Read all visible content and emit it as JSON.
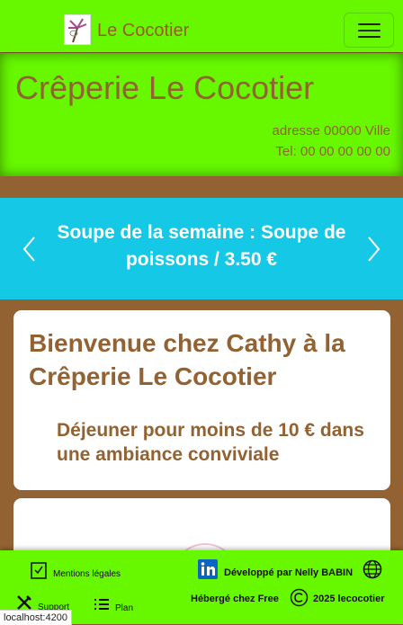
{
  "navbar": {
    "brand": "Le Cocotier",
    "logo_icon": "coconut-tree-logo",
    "menu_icon": "hamburger-menu-icon"
  },
  "header": {
    "title": "Crêperie Le Cocotier",
    "address": "adresse 00000 Ville",
    "phone": "Tel: 00 00 00 00 00"
  },
  "carousel": {
    "slide_text": "Soupe de la semaine : Soupe de poissons / 3.50 €",
    "prev_icon": "chevron-left-icon",
    "next_icon": "chevron-right-icon"
  },
  "welcome_card": {
    "title": "Bienvenue chez Cathy à la Crêperie Le Cocotier",
    "tagline": "Déjeuner pour moins de 10 € dans une ambiance conviviale"
  },
  "footer": {
    "legal": "Mentions légales",
    "support": "Support",
    "plan": "Plan",
    "developer": "Développé par Nelly BABIN",
    "hosting": "Hébergé chez Free",
    "copyright": "2025 lecocotier"
  },
  "status_bar": {
    "url": "localhost:4200"
  },
  "colors": {
    "green": "#67f800",
    "brown": "#936232",
    "cyan": "#15c9e6"
  }
}
